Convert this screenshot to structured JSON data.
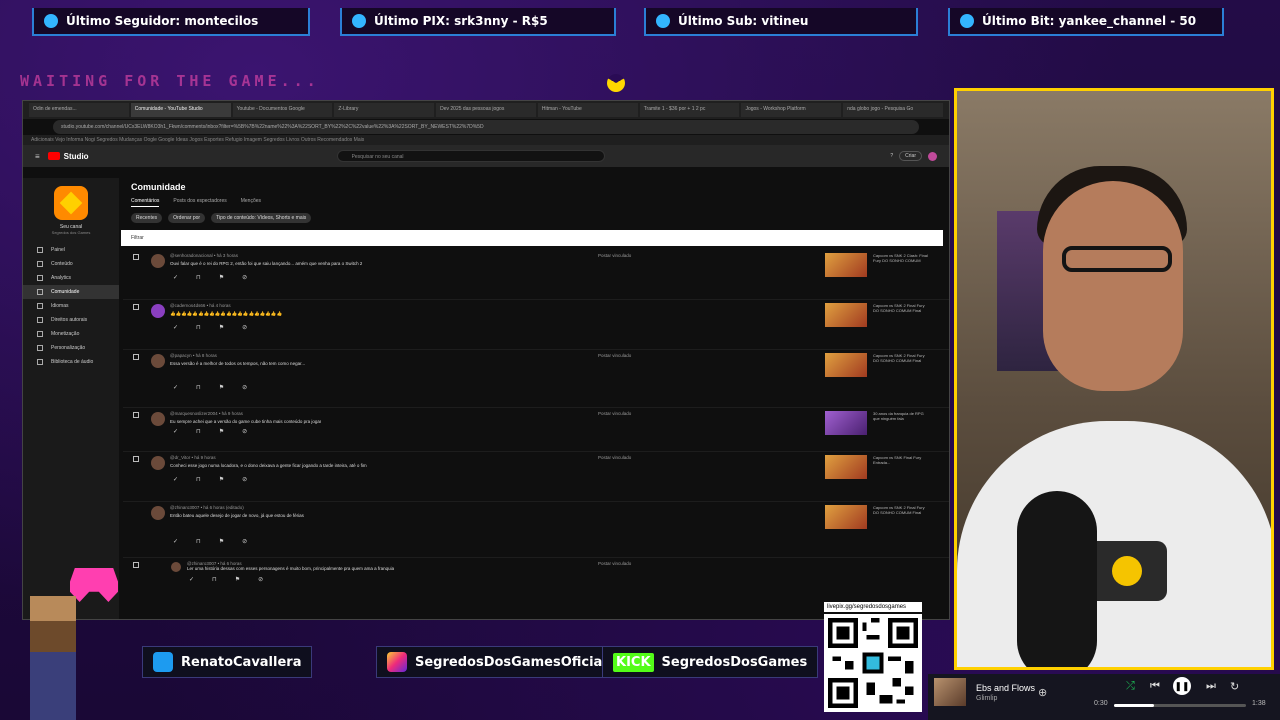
{
  "overlay": {
    "top_items": [
      {
        "label": "Último Seguidor: montecilos",
        "icon": "user-icon"
      },
      {
        "label": "Último PIX: srk3nny - R$5",
        "icon": "dollar-icon"
      },
      {
        "label": "Último Sub: vitineu",
        "icon": "star-icon"
      },
      {
        "label": "Último Bit: yankee_channel - 50",
        "icon": "diamond-icon"
      }
    ],
    "waiting_text": "WAITING FOR THE GAME...",
    "social": {
      "twitter": "RenatoCavallera",
      "instagram": "SegredosDosGamesOficial",
      "kick_badge": "KICK",
      "kick": "SegredosDosGames"
    },
    "qr_label": "livepix.gg/segredosdosgames"
  },
  "browser": {
    "tabs": [
      "Odin de emendas...",
      "Comunidade - YouTube Studio",
      "Youtube - Documentos Google",
      "Z-Library",
      "Dev 2025 das pessoas jogos",
      "Hitman - YouTube",
      "Tramite 1 - $36 por + 1 2 pc",
      "Jogos - Workshop Platform",
      "nda globo jogo - Pesquisa Go"
    ],
    "url": "studio.youtube.com/channel/UCx3ELW8KO3h1_Fkwn/comments/inbox?filter=%5B%7B%22name%22%3A%22SORT_BY%22%2C%22value%22%3A%22SORT_BY_NEWEST%22%7D%5D",
    "bookmarks": "Adicionais  Vejo  Informa  Nogi  Segredos  Mudanças  Oogle  Google Ideas  Jogos  Esportes  Refugio  Imagem  Segredos  Livros  Outros  Recomendados  Mais"
  },
  "studio": {
    "logo_text": "Studio",
    "search_placeholder": "Pesquisar no seu canal",
    "create_label": "Criar",
    "channel_name": "Seu canal",
    "channel_sub": "Segredos dos Games",
    "nav": [
      "Painel",
      "Conteúdo",
      "Analytics",
      "Comunidade",
      "Idiomas",
      "Direitos autorais",
      "Monetização",
      "Personalização",
      "Biblioteca de áudio"
    ],
    "page_title": "Comunidade",
    "subtabs": [
      "Comentários",
      "Posts dos espectadores",
      "Menções"
    ],
    "filters": [
      "Recentes",
      "Ordenar por",
      "Tipo de conteúdo: Vídeos, Shorts e mais"
    ],
    "filterbar_text": "Filtrar",
    "comments": [
      {
        "author": "@senhoradonacional • há 3 horas",
        "text": "Ouvi falar que é o rei do RPG 2, então foi que saiu lançando... amém que venha para o Switch 2",
        "status": "Postar vinculado",
        "video": "Capcom vs SNK 2 Clash: Final Fury DO SONHO COMUM"
      },
      {
        "author": "@cadernos4ds66 • há 4 horas",
        "text": "👍👍👍👍👍👍👍👍👍👍👍👍👍👍👍👍👍👍👍👍",
        "status": "",
        "video": "Capcom vs SNK 2 Final Fury DO SONHO COMUM Final"
      },
      {
        "author": "@papacyn • há 8 horas",
        "text": "Essa versão é a melhor de todos os tempos, não tem como negar...",
        "status": "Postar vinculado",
        "video": "Capcom vs SNK 2 Final Fury DO SONHO COMUM Final"
      },
      {
        "author": "@marquesnoslizer2004 • há 9 horas",
        "text": "Eu sempre achei que a versão do game cube tinha mais conteúdo pra jogar",
        "status": "Postar vinculado",
        "video": "30 anos da franquia de RPG que ninguém fala"
      },
      {
        "author": "@dr_Vitor • há 9 horas",
        "text": "Conheci esse jogo numa locadora, e o dono deixava a gente ficar jogando a tarde inteira, até o fim",
        "status": "Postar vinculado",
        "video": "Capcom vs SNK Final Fury Entrada..."
      },
      {
        "author": "@zhinaro3007 • há 6 horas (editado)",
        "text": "Então bateu aquele desejo de jogar de novo, já que estou de férias",
        "status": "",
        "video": "Capcom vs SNK 2 Final Fury DO SONHO COMUM Final"
      },
      {
        "author": "@zhinaro3007 • há 6 horas",
        "text": "Ler uma história dessas com esses personagens é muito bom, principalmente pra quem ama a franquia",
        "status": "Postar vinculado",
        "video": ""
      }
    ]
  },
  "player": {
    "title": "Ebs and Flows",
    "artist": "Glimlip",
    "time_current": "0:30",
    "time_total": "1:38",
    "progress": 0.3
  },
  "colors": {
    "accent_blue": "#2b7fd6",
    "webcam_border": "#ffd000",
    "youtube_red": "#ff0000",
    "kick_green": "#53fc18"
  }
}
